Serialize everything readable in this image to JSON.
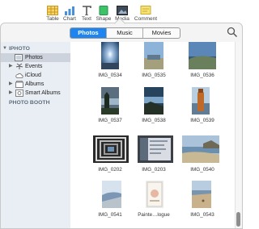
{
  "toolbar": {
    "items": [
      {
        "label": "Table",
        "icon": "table-icon"
      },
      {
        "label": "Chart",
        "icon": "chart-icon"
      },
      {
        "label": "Text",
        "icon": "text-icon"
      },
      {
        "label": "Shape",
        "icon": "shape-icon"
      },
      {
        "label": "Media",
        "icon": "media-icon"
      },
      {
        "label": "Comment",
        "icon": "comment-icon"
      }
    ]
  },
  "tabs": [
    {
      "label": "Photos",
      "active": true
    },
    {
      "label": "Music",
      "active": false
    },
    {
      "label": "Movies",
      "active": false
    }
  ],
  "search": {
    "icon": "search-icon"
  },
  "sidebar": {
    "sections": [
      {
        "header": "IPHOTO",
        "items": [
          {
            "label": "Photos",
            "icon": "photos-icon",
            "selected": true
          },
          {
            "label": "Events",
            "icon": "events-icon",
            "disclosure": true
          },
          {
            "label": "iCloud",
            "icon": "icloud-icon"
          },
          {
            "label": "Albums",
            "icon": "albums-icon",
            "disclosure": true
          },
          {
            "label": "Smart Albums",
            "icon": "smart-albums-icon",
            "disclosure": true
          }
        ]
      },
      {
        "header": "PHOTO BOOTH",
        "items": []
      }
    ]
  },
  "photos": [
    {
      "label": "IMG_0534"
    },
    {
      "label": "IMG_0535"
    },
    {
      "label": "IMG_0536"
    },
    {
      "label": "IMG_0537"
    },
    {
      "label": "IMG_0538"
    },
    {
      "label": "IMG_0539"
    },
    {
      "label": "IMG_0202"
    },
    {
      "label": "IMG_0203"
    },
    {
      "label": "IMG_0540"
    },
    {
      "label": "IMG_0541"
    },
    {
      "label": "Painte…logue"
    },
    {
      "label": "IMG_0543"
    }
  ],
  "colors": {
    "accent": "#1d84f0",
    "sidebar_bg": "#e9eef4",
    "sidebar_selected": "#cdd3dc"
  }
}
